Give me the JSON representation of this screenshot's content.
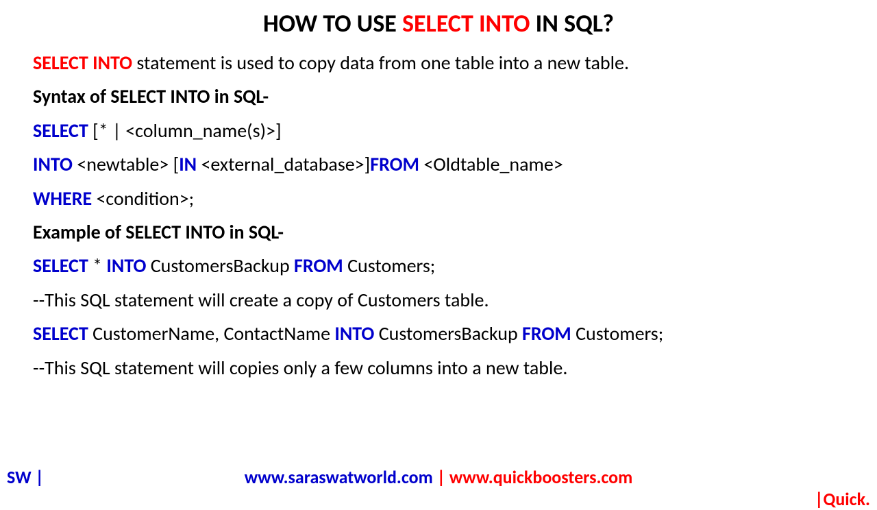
{
  "title": {
    "part1": "HOW TO USE ",
    "highlight": "SELECT INTO",
    "part2": " IN SQL?"
  },
  "intro": {
    "keyword": "SELECT INTO",
    "text": " statement is used to copy data from one table into a new table."
  },
  "syntaxHeader": "Syntax of SELECT INTO in SQL-",
  "syntax": {
    "line1": {
      "kw1": "SELECT",
      "txt1": " [* | <column_name(s)>]"
    },
    "line2": {
      "kw1": "INTO",
      "txt1": " <newtable> [",
      "kw2": "IN",
      "txt2": " <external_database>]",
      "kw3": "FROM",
      "txt3": " <Oldtable_name>"
    },
    "line3": {
      "kw1": "WHERE",
      "txt1": " <condition>;"
    }
  },
  "exampleHeader": "Example of SELECT INTO in SQL-",
  "example1": {
    "kw1": "SELECT",
    "txt1": " * ",
    "kw2": "INTO",
    "txt2": " CustomersBackup ",
    "kw3": "FROM",
    "txt3": " Customers;"
  },
  "comment1": "--This SQL statement will create a copy of Customers table.",
  "example2": {
    "kw1": "SELECT",
    "txt1": " CustomerName, ContactName ",
    "kw2": "INTO",
    "txt2": " CustomersBackup ",
    "kw3": "FROM",
    "txt3": " Customers;"
  },
  "comment2": "--This SQL statement will copies only a few columns into a new table.",
  "footer": {
    "left": "SW |",
    "centerBlue": "www.saraswatworld.com",
    "centerSep": " | ",
    "centerRed": "www.quickboosters.com",
    "right": "|Quick."
  }
}
